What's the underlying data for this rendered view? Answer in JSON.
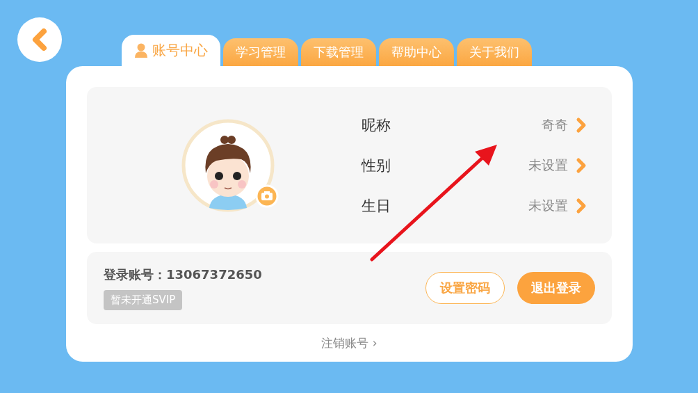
{
  "tabs": [
    {
      "label": "账号中心",
      "selected": true
    },
    {
      "label": "学习管理",
      "selected": false
    },
    {
      "label": "下载管理",
      "selected": false
    },
    {
      "label": "帮助中心",
      "selected": false
    },
    {
      "label": "关于我们",
      "selected": false
    }
  ],
  "profile": [
    {
      "label": "昵称",
      "value": "奇奇"
    },
    {
      "label": "性别",
      "value": "未设置"
    },
    {
      "label": "生日",
      "value": "未设置"
    }
  ],
  "account": {
    "label": "登录账号：",
    "number": "13067372650",
    "badge": "暂未开通SVIP"
  },
  "buttons": [
    {
      "label": "设置密码",
      "kind": "outline"
    },
    {
      "label": "退出登录",
      "kind": "filled"
    }
  ],
  "cancel_link": "注销账号 ›"
}
